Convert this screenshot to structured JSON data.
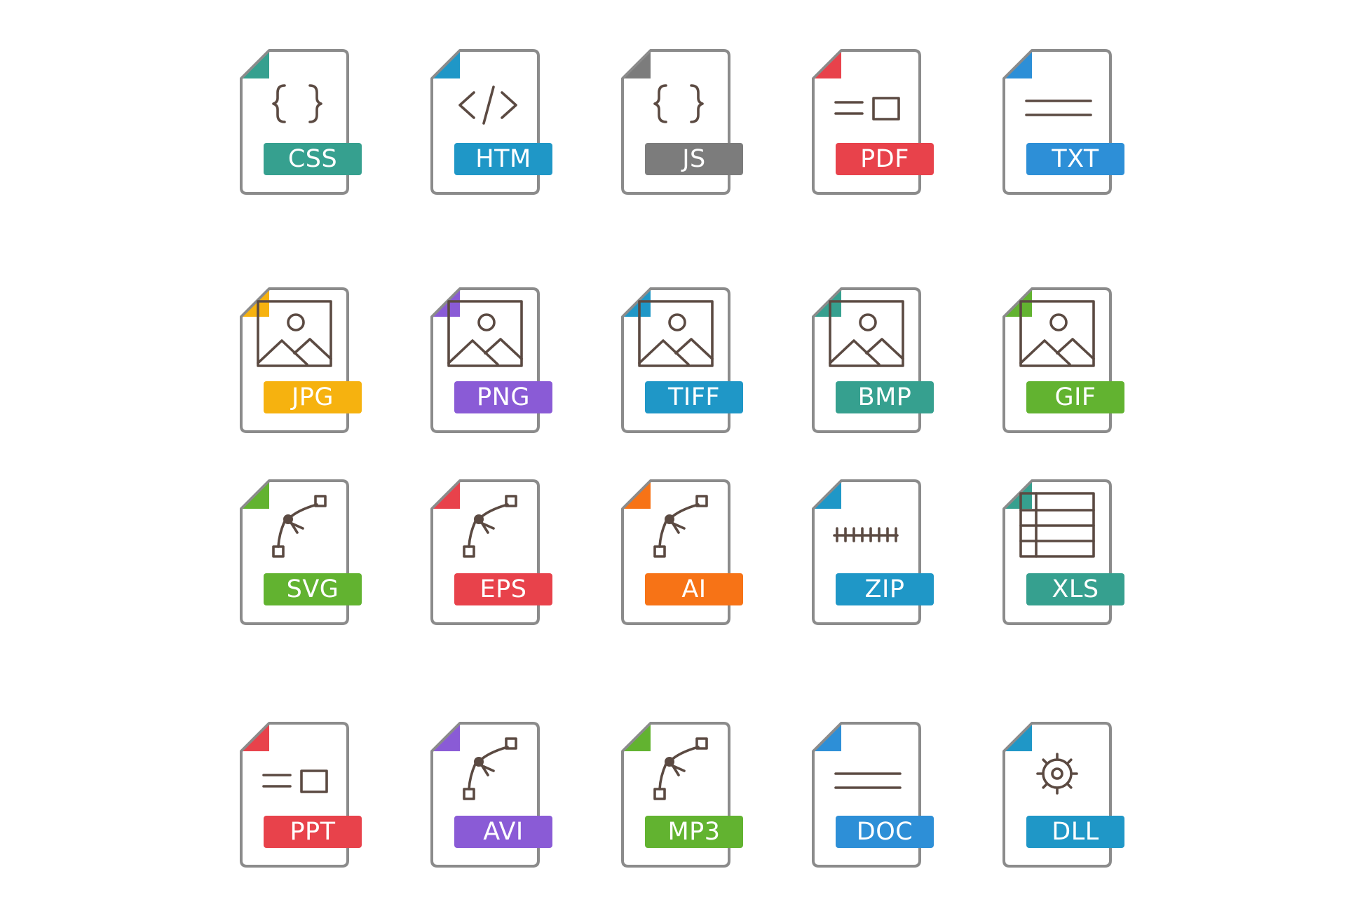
{
  "icons": [
    {
      "label": "CSS",
      "color": "#36a08f",
      "corner": "#36a08f",
      "glyph": "braces-icon"
    },
    {
      "label": "HTM",
      "color": "#1f97c7",
      "corner": "#1f97c7",
      "glyph": "code-tag-icon"
    },
    {
      "label": "JS",
      "color": "#7c7c7c",
      "corner": "#7c7c7c",
      "glyph": "braces-icon"
    },
    {
      "label": "PDF",
      "color": "#e8424b",
      "corner": "#e8424b",
      "glyph": "slide-layout-icon"
    },
    {
      "label": "TXT",
      "color": "#2d8fd7",
      "corner": "#2d8fd7",
      "glyph": "text-lines-icon"
    },
    {
      "label": "JPG",
      "color": "#f6b20f",
      "corner": "#f6b20f",
      "glyph": "image-icon"
    },
    {
      "label": "PNG",
      "color": "#8a5bd6",
      "corner": "#8a5bd6",
      "glyph": "image-icon"
    },
    {
      "label": "TIFF",
      "color": "#1f97c7",
      "corner": "#1f97c7",
      "glyph": "image-icon"
    },
    {
      "label": "BMP",
      "color": "#36a08f",
      "corner": "#36a08f",
      "glyph": "image-icon"
    },
    {
      "label": "GIF",
      "color": "#62b330",
      "corner": "#62b330",
      "glyph": "image-icon"
    },
    {
      "label": "SVG",
      "color": "#62b330",
      "corner": "#62b330",
      "glyph": "bezier-curve-icon"
    },
    {
      "label": "EPS",
      "color": "#e8424b",
      "corner": "#e8424b",
      "glyph": "bezier-curve-icon"
    },
    {
      "label": "AI",
      "color": "#f77316",
      "corner": "#f77316",
      "glyph": "bezier-curve-icon"
    },
    {
      "label": "ZIP",
      "color": "#1f97c7",
      "corner": "#1f97c7",
      "glyph": "zipper-icon"
    },
    {
      "label": "XLS",
      "color": "#36a08f",
      "corner": "#36a08f",
      "glyph": "spreadsheet-grid-icon"
    },
    {
      "label": "PPT",
      "color": "#e8424b",
      "corner": "#e8424b",
      "glyph": "slide-layout-icon"
    },
    {
      "label": "AVI",
      "color": "#8a5bd6",
      "corner": "#8a5bd6",
      "glyph": "bezier-curve-icon"
    },
    {
      "label": "MP3",
      "color": "#62b330",
      "corner": "#62b330",
      "glyph": "bezier-curve-icon"
    },
    {
      "label": "DOC",
      "color": "#2d8fd7",
      "corner": "#2d8fd7",
      "glyph": "text-lines-icon"
    },
    {
      "label": "DLL",
      "color": "#1f97c7",
      "corner": "#1f97c7",
      "glyph": "gear-icon"
    }
  ]
}
